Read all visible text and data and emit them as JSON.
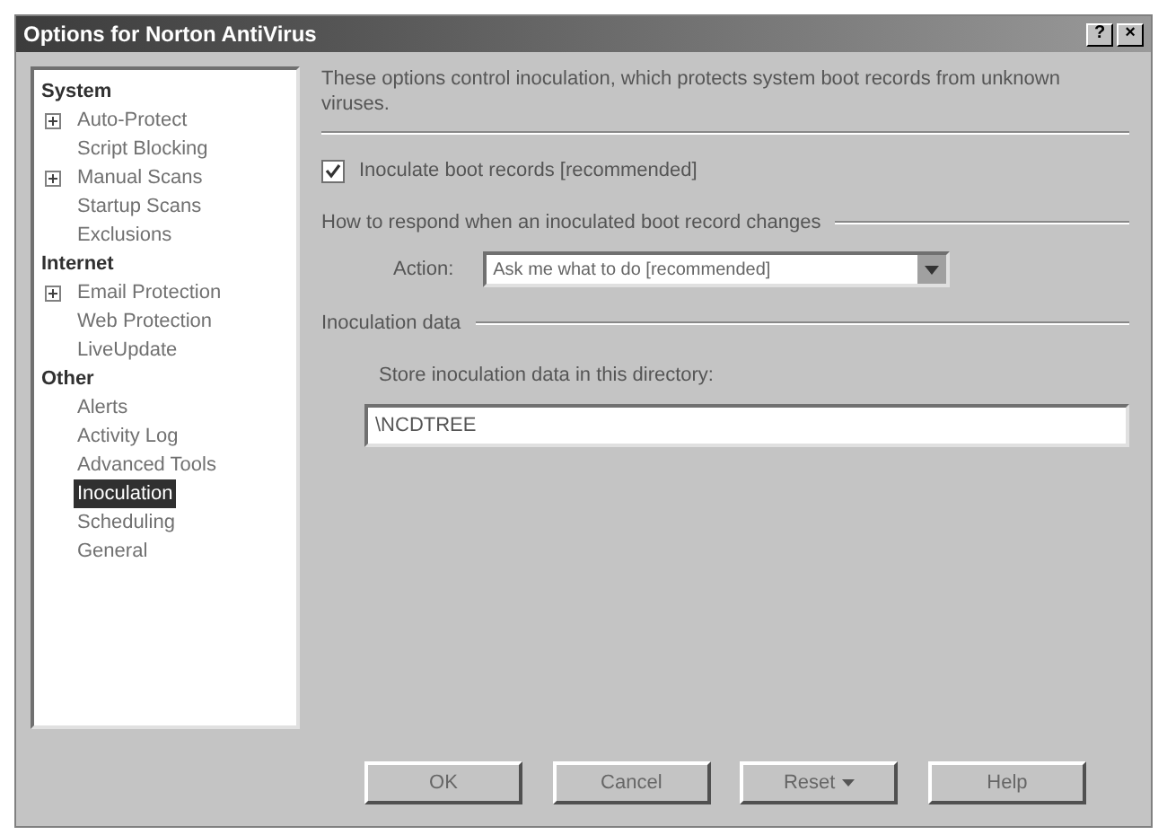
{
  "window": {
    "title": "Options for Norton AntiVirus",
    "title_buttons": [
      "?",
      "×"
    ]
  },
  "sidebar": {
    "groups": [
      {
        "heading": "System",
        "items": [
          {
            "label": "Auto-Protect",
            "expandable": true,
            "selected": false
          },
          {
            "label": "Script Blocking",
            "expandable": false,
            "selected": false
          },
          {
            "label": "Manual Scans",
            "expandable": true,
            "selected": false
          },
          {
            "label": "Startup Scans",
            "expandable": false,
            "selected": false
          },
          {
            "label": "Exclusions",
            "expandable": false,
            "selected": false
          }
        ]
      },
      {
        "heading": "Internet",
        "items": [
          {
            "label": "Email Protection",
            "expandable": true,
            "selected": false
          },
          {
            "label": "Web Protection",
            "expandable": false,
            "selected": false
          },
          {
            "label": "LiveUpdate",
            "expandable": false,
            "selected": false
          }
        ]
      },
      {
        "heading": "Other",
        "items": [
          {
            "label": "Alerts",
            "expandable": false,
            "selected": false
          },
          {
            "label": "Activity Log",
            "expandable": false,
            "selected": false
          },
          {
            "label": "Advanced Tools",
            "expandable": false,
            "selected": false
          },
          {
            "label": "Inoculation",
            "expandable": false,
            "selected": true
          },
          {
            "label": "Scheduling",
            "expandable": false,
            "selected": false
          },
          {
            "label": "General",
            "expandable": false,
            "selected": false
          }
        ]
      }
    ]
  },
  "description": "These options control inoculation, which protects system boot records from unknown viruses.",
  "inoculate_checkbox": {
    "label": "Inoculate boot records [recommended]",
    "checked": true
  },
  "respond_group": {
    "title": "How to respond when an inoculated boot record changes",
    "action_label": "Action:",
    "action_value": "Ask me what to do [recommended]"
  },
  "data_group": {
    "title": "Inoculation data",
    "store_label": "Store inoculation data in this directory:",
    "directory": "\\NCDTREE"
  },
  "buttons": [
    {
      "label": "OK",
      "dropdown": false
    },
    {
      "label": "Cancel",
      "dropdown": false
    },
    {
      "label": "Reset",
      "dropdown": true
    },
    {
      "label": "Help",
      "dropdown": false
    }
  ]
}
